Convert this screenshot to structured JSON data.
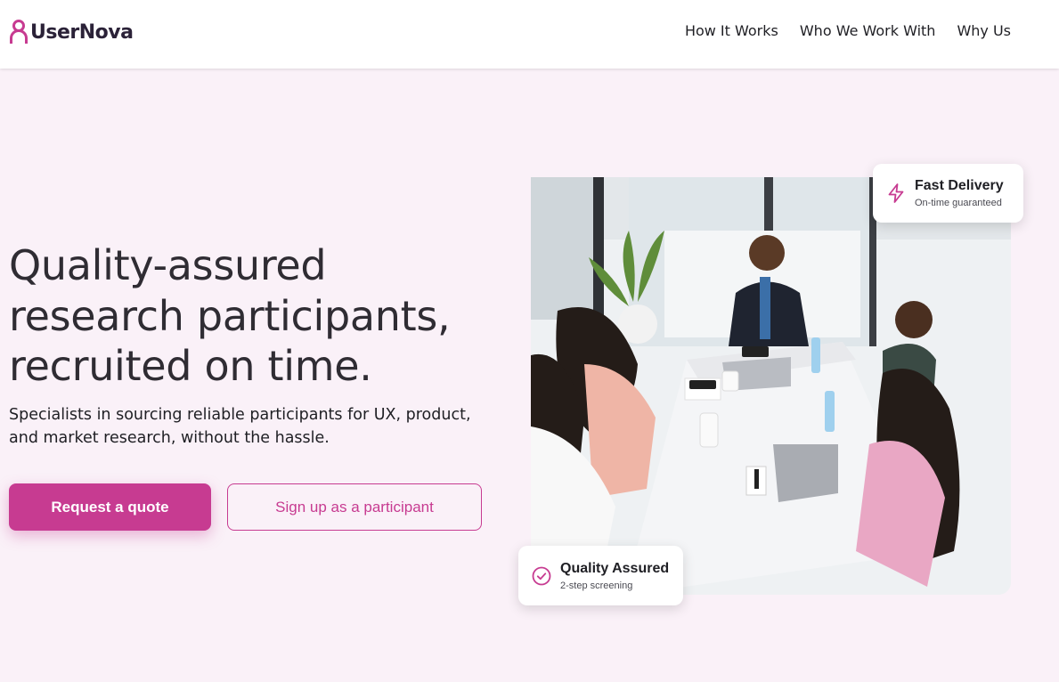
{
  "header": {
    "brand": "UserNova",
    "nav": [
      {
        "label": "How It Works"
      },
      {
        "label": "Who We Work With"
      },
      {
        "label": "Why Us"
      }
    ]
  },
  "hero": {
    "title_lines": [
      "Quality-assured",
      "research participants,",
      "recruited on time."
    ],
    "subtitle": "Specialists in sourcing reliable participants for UX, product, and market research, without the hassle.",
    "primary_cta": "Request a quote",
    "secondary_cta": "Sign up as a participant"
  },
  "badges": {
    "fast": {
      "title": "Fast Delivery",
      "desc": "On-time guaranteed",
      "icon": "lightning-icon"
    },
    "quality": {
      "title": "Quality Assured",
      "desc": "2-step screening",
      "icon": "check-circle-icon"
    }
  },
  "colors": {
    "accent": "#c73b91",
    "background": "#faf1f8",
    "header": "#ffffff",
    "text": "#2f2c33"
  }
}
